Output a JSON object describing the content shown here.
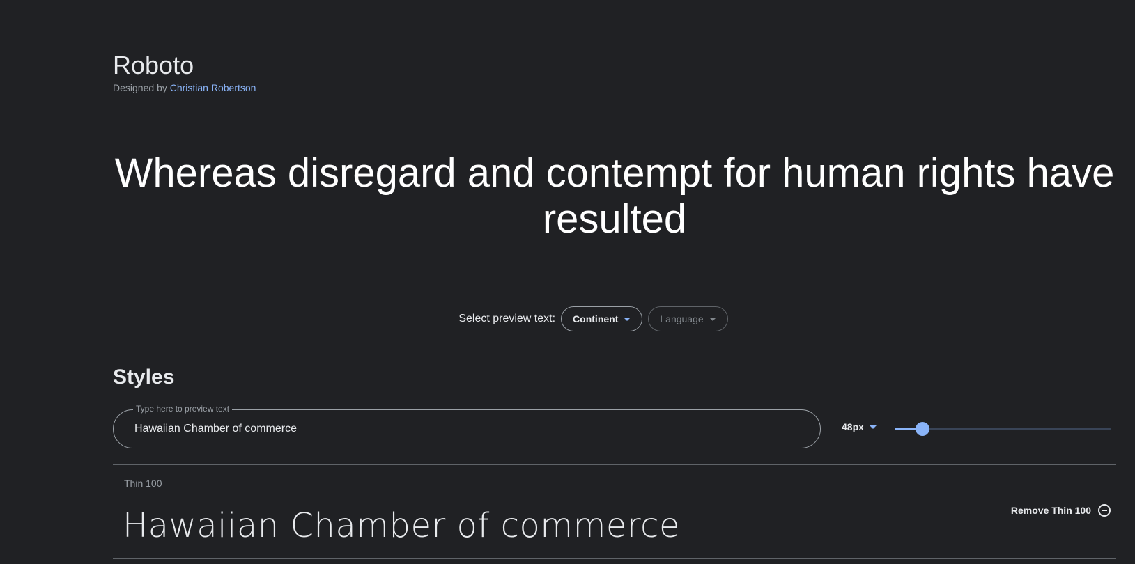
{
  "font": {
    "name": "Roboto",
    "designed_by_prefix": "Designed by",
    "designer": "Christian Robertson"
  },
  "hero": {
    "text": "Whereas disregard and contempt for human rights have resulted"
  },
  "preview_select": {
    "label": "Select preview text:",
    "continent": "Continent",
    "language": "Language"
  },
  "styles": {
    "heading": "Styles",
    "preview_legend": "Type here to preview text",
    "preview_value": "Hawaiian Chamber of commerce",
    "size_label": "48px",
    "size_slider_fraction": 0.13,
    "rows": [
      {
        "name": "Thin 100",
        "sample": "Hawaiian Chamber of commerce",
        "remove_label": "Remove Thin 100"
      }
    ]
  },
  "colors": {
    "background": "#202124",
    "accent": "#8ab4f8",
    "text": "#e8eaed",
    "muted": "#9aa0a6"
  }
}
